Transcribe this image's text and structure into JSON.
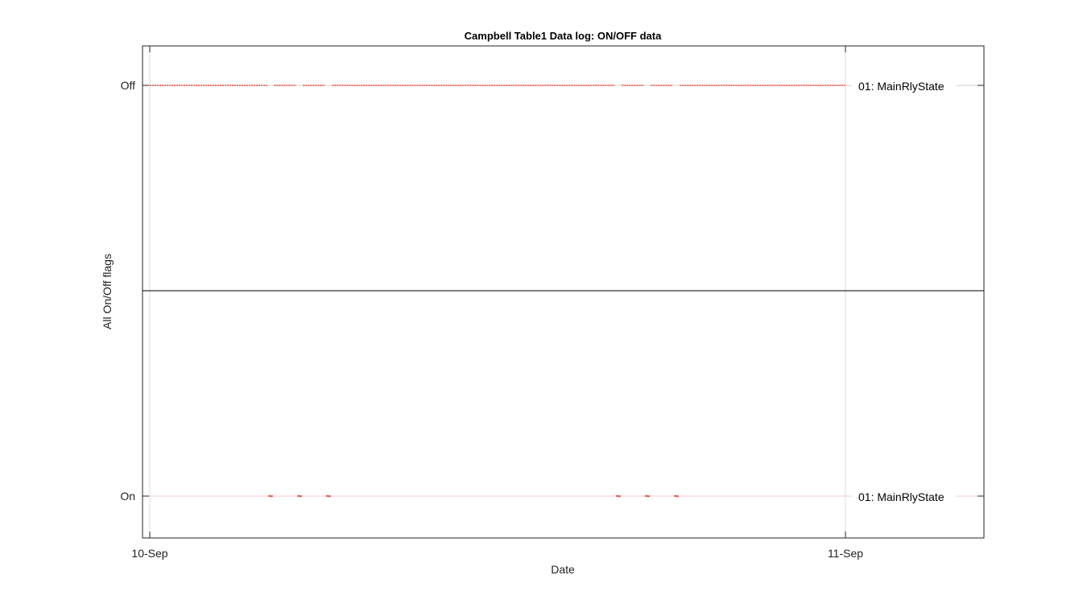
{
  "chart_data": {
    "type": "line",
    "title": "Campbell Table1 Data log: ON/OFF data",
    "xlabel": "Date",
    "ylabel": "All On/Off flags",
    "x_ticks": [
      "10-Sep",
      "11-Sep"
    ],
    "xlim": [
      "10-Sep 00:00",
      "11-Sep 04:00"
    ],
    "y_ticks": [
      "On",
      "Off"
    ],
    "ylim": [
      -0.1,
      1.1
    ],
    "grid": true,
    "series": [
      {
        "name": "01: MainRlyState",
        "color": "#e8483c",
        "states": [
          {
            "from": "10-Sep 00:00",
            "to": "11-Sep 00:00",
            "value": "Off"
          },
          {
            "at": "10-Sep 04:10",
            "value": "On"
          },
          {
            "at": "10-Sep 05:10",
            "value": "On"
          },
          {
            "at": "10-Sep 06:10",
            "value": "On"
          },
          {
            "at": "10-Sep 16:10",
            "value": "On"
          },
          {
            "at": "10-Sep 17:10",
            "value": "On"
          },
          {
            "at": "10-Sep 18:10",
            "value": "On"
          }
        ]
      }
    ],
    "annotations": [
      {
        "text": "01: MainRlyState",
        "level": "Off"
      },
      {
        "text": "01: MainRlyState",
        "level": "On"
      }
    ]
  }
}
